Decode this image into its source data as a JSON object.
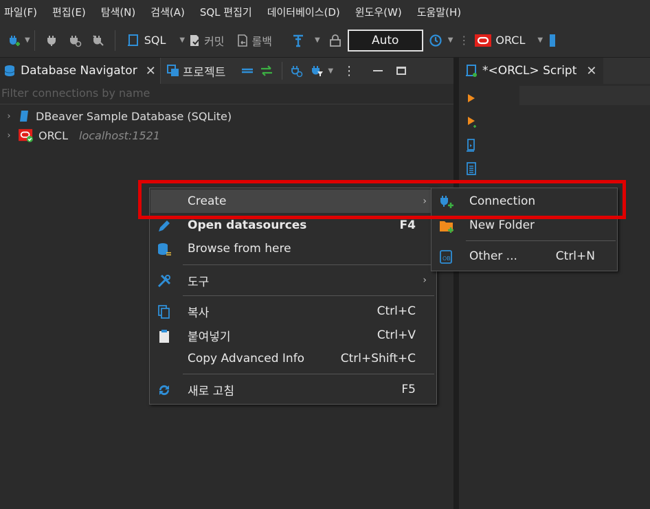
{
  "menubar": {
    "items": [
      "파일(F)",
      "편집(E)",
      "탐색(N)",
      "검색(A)",
      "SQL 편집기",
      "데이터베이스(D)",
      "윈도우(W)",
      "도움말(H)"
    ]
  },
  "toolbar": {
    "sql_label": "SQL",
    "commit_label": "커밋",
    "rollback_label": "롤백",
    "auto_label": "Auto",
    "connection_label": "ORCL"
  },
  "left_panel": {
    "tab_active": "Database Navigator",
    "tab_projects": "프로젝트",
    "filter_placeholder": "Filter connections by name",
    "tree": [
      {
        "name": "DBeaver Sample Database (SQLite)",
        "detail": ""
      },
      {
        "name": "ORCL",
        "detail": "localhost:1521"
      }
    ]
  },
  "right_panel": {
    "tab_label": "*<ORCL> Script"
  },
  "context_menu": {
    "items": [
      {
        "label": "Create",
        "shortcut": "",
        "has_submenu": true,
        "icon": "none"
      },
      {
        "label": "Open datasources",
        "shortcut": "F4",
        "bold": true,
        "icon": "pencil-icon"
      },
      {
        "label": "Browse from here",
        "shortcut": "",
        "icon": "database-browse-icon"
      },
      {
        "label": "도구",
        "shortcut": "",
        "has_submenu": true,
        "icon": "tools-icon"
      },
      {
        "label": "복사",
        "shortcut": "Ctrl+C",
        "icon": "copy-icon"
      },
      {
        "label": "붙여넣기",
        "shortcut": "Ctrl+V",
        "icon": "paste-icon"
      },
      {
        "label": "Copy Advanced Info",
        "shortcut": "Ctrl+Shift+C",
        "icon": "none"
      },
      {
        "label": "새로 고침",
        "shortcut": "F5",
        "icon": "refresh-icon"
      }
    ]
  },
  "submenu": {
    "items": [
      {
        "label": "Connection",
        "shortcut": "",
        "icon": "new-connection-icon"
      },
      {
        "label": "New Folder",
        "shortcut": "",
        "icon": "new-folder-icon"
      },
      {
        "label": "Other ...",
        "shortcut": "Ctrl+N",
        "icon": "new-object-icon"
      }
    ]
  },
  "colors": {
    "highlight": "#e00000",
    "accent_blue": "#2f8fd8",
    "oracle_red": "#e0201a",
    "success_green": "#3cb043",
    "run_orange": "#f08a1c"
  }
}
